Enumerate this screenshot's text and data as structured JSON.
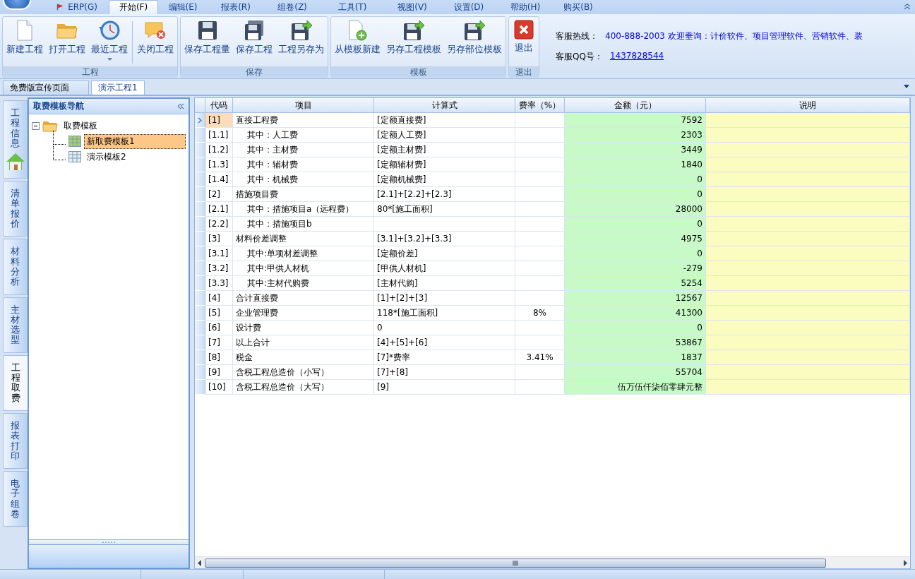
{
  "menu": [
    {
      "label": "ERP(G)",
      "selected": false,
      "kind": "flag"
    },
    {
      "label": "开始(F)",
      "selected": true
    },
    {
      "label": "编辑(E)",
      "selected": false
    },
    {
      "label": "报表(R)",
      "selected": false
    },
    {
      "label": "组卷(Z)",
      "selected": false
    },
    {
      "label": "工具(T)",
      "selected": false
    },
    {
      "label": "视图(V)",
      "selected": false
    },
    {
      "label": "设置(D)",
      "selected": false
    },
    {
      "label": "帮助(H)",
      "selected": false
    },
    {
      "label": "购买(B)",
      "selected": false
    }
  ],
  "ribbon": [
    {
      "title": "工程",
      "buttons": [
        {
          "label": "新建工程",
          "kind": "new"
        },
        {
          "label": "打开工程",
          "kind": "open"
        },
        {
          "label": "最近工程",
          "kind": "recent",
          "has_menu": true
        },
        {
          "label": "关闭工程",
          "kind": "close",
          "separator_before": true
        }
      ]
    },
    {
      "title": "保存",
      "buttons": [
        {
          "label": "保存工程量",
          "kind": "save"
        },
        {
          "label": "保存工程",
          "kind": "saveall"
        },
        {
          "label": "工程另存为",
          "kind": "saveas"
        }
      ]
    },
    {
      "title": "模板",
      "buttons": [
        {
          "label": "从模板新建",
          "kind": "newfrom"
        },
        {
          "label": "另存工程模板",
          "kind": "saveas"
        },
        {
          "label": "另存部位模板",
          "kind": "saveas"
        }
      ]
    },
    {
      "title": "退出",
      "buttons": [
        {
          "label": "退出",
          "kind": "exit"
        }
      ]
    }
  ],
  "info": {
    "hotline_label": "客服热线：",
    "hotline": "400-888-2003 欢迎垂询：计价软件、项目管理软件、营销软件、装",
    "qq_label": "客服QQ号：",
    "qq": "1437828544"
  },
  "doc_tabs": [
    {
      "label": "免费版宣传页面",
      "selected": false
    },
    {
      "label": "演示工程1",
      "selected": true
    }
  ],
  "side_tabs": [
    {
      "label": "工程信息",
      "selected": false,
      "kind": "home"
    },
    {
      "label": "清单报价",
      "selected": false
    },
    {
      "label": "材料分析",
      "selected": false
    },
    {
      "label": "主材选型",
      "selected": false
    },
    {
      "label": "工程取费",
      "selected": true
    },
    {
      "label": "报表打印",
      "selected": false
    },
    {
      "label": "电子组卷",
      "selected": false
    }
  ],
  "nav": {
    "title": "取费模板导航",
    "tree": [
      {
        "label": "取费模板",
        "expanded": true,
        "children": [
          {
            "label": "新取费模板1",
            "selected": true
          },
          {
            "label": "演示模板2",
            "selected": false
          }
        ]
      }
    ]
  },
  "table": {
    "columns": [
      "代码",
      "项目",
      "计算式",
      "费率（%）",
      "金额（元）",
      "说明"
    ],
    "rows": [
      {
        "code": "[1]",
        "item": "直接工程费",
        "formula": "[定额直接费]",
        "amount": "7592",
        "selected": true,
        "children": [
          {
            "code": "[1.1]",
            "item": "其中：人工费",
            "formula": "[定额人工费]",
            "amount": "2303",
            "selected": false
          },
          {
            "code": "[1.2]",
            "item": "其中：主材费",
            "formula": "[定额主材费]",
            "amount": "3449",
            "selected": false
          },
          {
            "code": "[1.3]",
            "item": "其中：辅材费",
            "formula": "[定额辅材费]",
            "amount": "1840",
            "selected": false
          },
          {
            "code": "[1.4]",
            "item": "其中：机械费",
            "formula": "[定额机械费]",
            "amount": "0",
            "selected": false
          }
        ]
      },
      {
        "code": "[2]",
        "item": "措施项目费",
        "formula": "[2.1]+[2.2]+[2.3]",
        "amount": "0",
        "selected": false,
        "children": [
          {
            "code": "[2.1]",
            "item": "其中：措施项目a（远程费）",
            "formula": "80*[施工面积]",
            "amount": "28000",
            "selected": false
          },
          {
            "code": "[2.2]",
            "item": "其中：措施项目b",
            "amount": "0",
            "selected": false
          }
        ]
      },
      {
        "code": "[3]",
        "item": "材料价差调整",
        "formula": "[3.1]+[3.2]+[3.3]",
        "amount": "4975",
        "selected": false,
        "children": [
          {
            "code": "[3.1]",
            "item": "其中:单项材差调整",
            "formula": "[定额价差]",
            "amount": "0",
            "selected": false
          },
          {
            "code": "[3.2]",
            "item": "其中:甲供人材机",
            "formula": "[甲供人材机]",
            "amount": "-279",
            "selected": false
          },
          {
            "code": "[3.3]",
            "item": "其中:主材代购费",
            "formula": "[主材代购]",
            "amount": "5254",
            "selected": false
          }
        ]
      },
      {
        "code": "[4]",
        "item": "合计直接费",
        "formula": "[1]+[2]+[3]",
        "amount": "12567",
        "selected": false
      },
      {
        "code": "[5]",
        "item": "企业管理费",
        "formula": "118*[施工面积]",
        "rate": "8%",
        "amount": "41300",
        "selected": false
      },
      {
        "code": "[6]",
        "item": "设计费",
        "formula": "0",
        "amount": "0",
        "selected": false
      },
      {
        "code": "[7]",
        "item": "以上合计",
        "formula": "[4]+[5]+[6]",
        "amount": "53867",
        "selected": false
      },
      {
        "code": "[8]",
        "item": "税金",
        "formula": "[7]*费率",
        "rate": "3.41%",
        "amount": "1837",
        "selected": false
      },
      {
        "code": "[9]",
        "item": "含税工程总造价（小写）",
        "formula": "[7]+[8]",
        "amount": "55704",
        "selected": false
      },
      {
        "code": "[10]",
        "item": "含税工程总造价（大写）",
        "formula": "[9]",
        "amount": "伍万伍仟柒佰零肆元整",
        "selected": false
      }
    ]
  }
}
